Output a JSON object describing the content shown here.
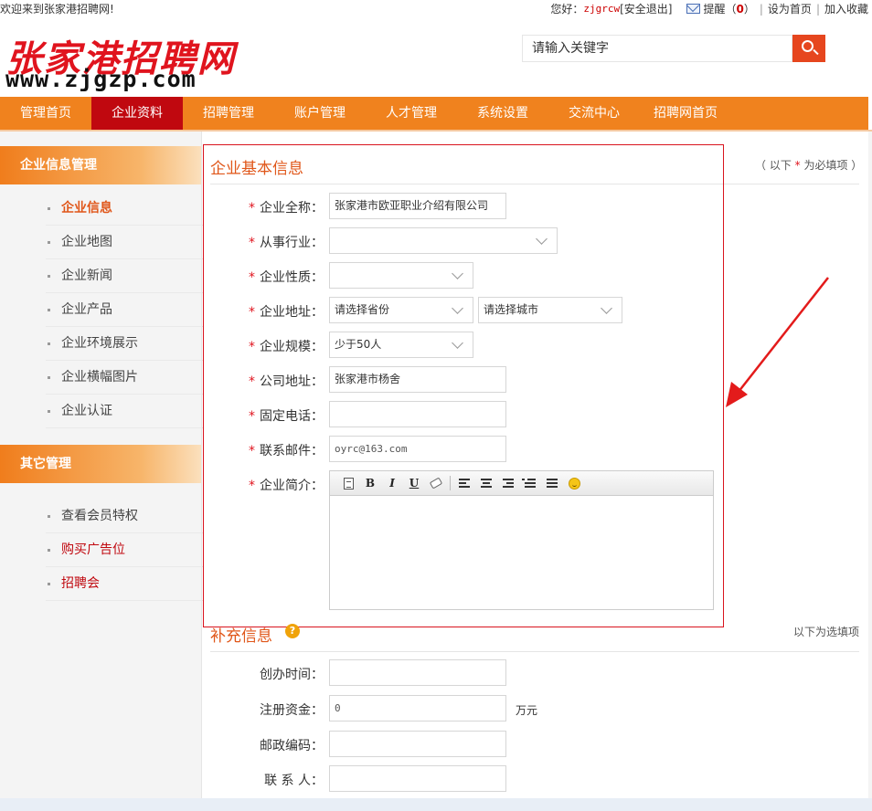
{
  "topbar": {
    "welcome": "欢迎来到张家港招聘网!",
    "greeting": "您好：",
    "username": "zjgrcw",
    "logout": "[安全退出]",
    "remind_label": "提醒",
    "remind_open": "（",
    "remind_count": "0",
    "remind_close": "）",
    "set_home": "设为首页",
    "add_fav": "加入收藏",
    "sep": "|"
  },
  "logo": {
    "cn": "张家港招聘网",
    "url": "www.zjgzp.com"
  },
  "search": {
    "placeholder": "请输入关键字"
  },
  "nav": [
    "管理首页",
    "企业资料",
    "招聘管理",
    "账户管理",
    "人才管理",
    "系统设置",
    "交流中心",
    "招聘网首页"
  ],
  "sidebar": {
    "group1": {
      "title": "企业信息管理",
      "items": [
        "企业信息",
        "企业地图",
        "企业新闻",
        "企业产品",
        "企业环境展示",
        "企业横幅图片",
        "企业认证"
      ]
    },
    "group2": {
      "title": "其它管理",
      "items": [
        "查看会员特权",
        "购买广告位",
        "招聘会"
      ]
    }
  },
  "basic": {
    "title": "企业基本信息",
    "note_open": "（ 以下",
    "note_star": "*",
    "note_close": "为必填项 ）",
    "star": "*",
    "labels": {
      "name": "企业全称：",
      "industry": "从事行业：",
      "nature": "企业性质：",
      "address": "企业地址：",
      "scale": "企业规模：",
      "company_addr": "公司地址：",
      "phone": "固定电话：",
      "email": "联系邮件：",
      "intro": "企业简介："
    },
    "values": {
      "name": "张家港市欧亚职业介绍有限公司",
      "industry": "",
      "nature": "",
      "province": "请选择省份",
      "city": "请选择城市",
      "scale": "少于50人",
      "company_addr": "张家港市杨舍",
      "phone": "",
      "email": "oyrc@163.com"
    },
    "editor_tools": [
      "source",
      "B",
      "I",
      "U",
      "eraser",
      "align-left",
      "align-center",
      "align-right",
      "ordered-list",
      "unordered-list",
      "emoticon"
    ],
    "editor_labels": {
      "bold": "B",
      "italic": "I",
      "underline": "U"
    }
  },
  "extra": {
    "title": "补充信息",
    "help": "?",
    "note": "以下为选填项",
    "labels": {
      "founded": "创办时间：",
      "capital": "注册资金：",
      "zip": "邮政编码：",
      "contact": "联 系 人："
    },
    "values": {
      "founded": "",
      "capital": "0",
      "zip": "",
      "contact": ""
    },
    "capital_unit": "万元"
  },
  "colors": {
    "nav": "#f0821e",
    "nav_active": "#c0080f",
    "accent": "#e0571a",
    "required": "#e0141e",
    "highlight_box": "#d9141e"
  }
}
